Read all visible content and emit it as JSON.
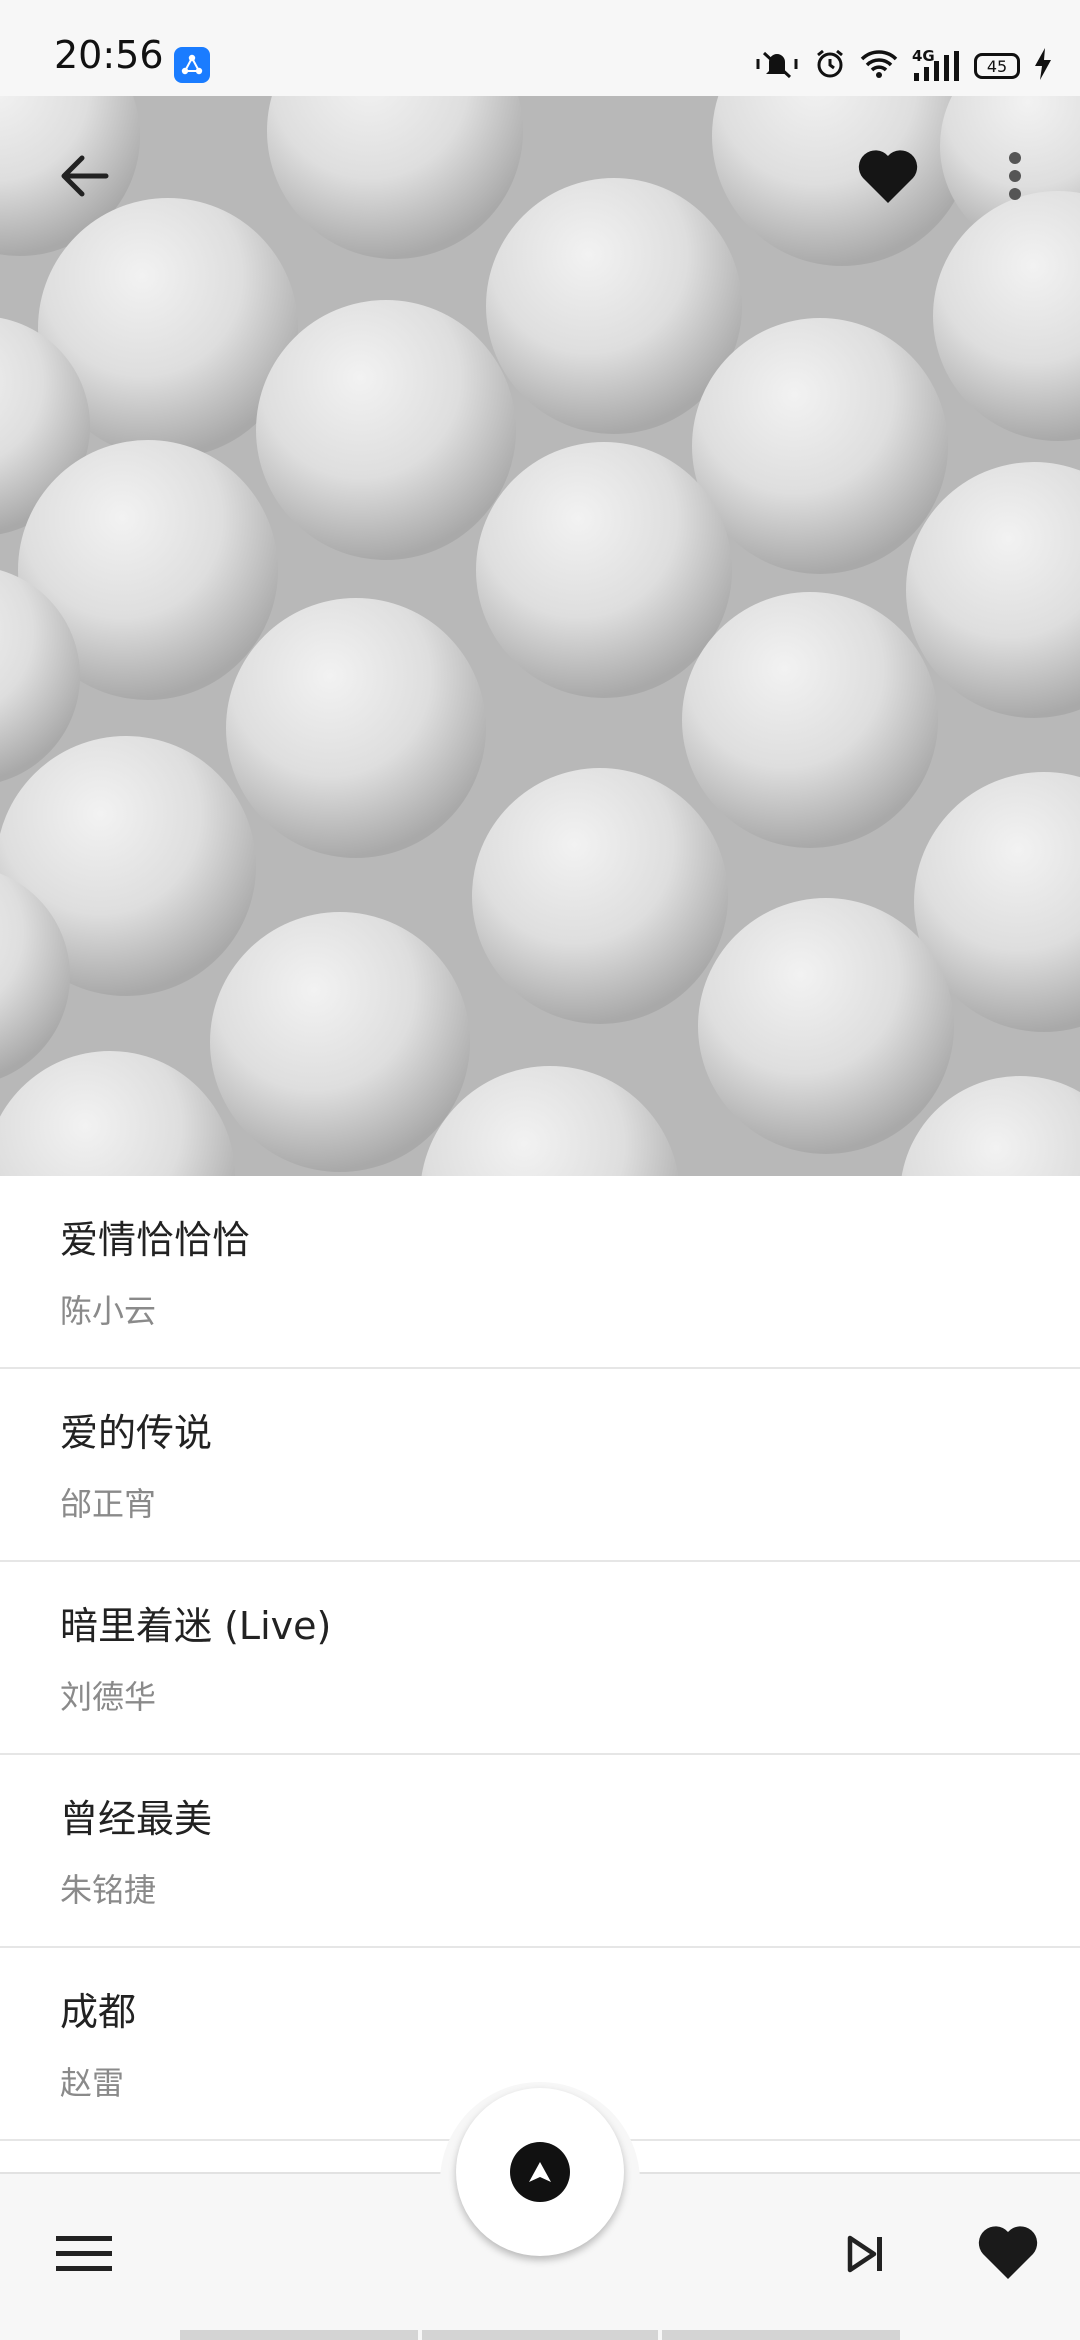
{
  "status_bar": {
    "time": "20:56",
    "app_icon": "app-share-icon",
    "icons": [
      "mute-vibrate-icon",
      "alarm-icon",
      "wifi-icon",
      "signal-4g-icon",
      "battery-icon",
      "charging-icon"
    ],
    "network": "4G",
    "battery_level": "45"
  },
  "header": {
    "back_icon": "arrow-left-icon",
    "favorite_icon": "heart-icon",
    "more_icon": "more-vertical-icon"
  },
  "songs": [
    {
      "title": "爱情恰恰恰",
      "artist": "陈小云"
    },
    {
      "title": "爱的传说",
      "artist": "邰正宵"
    },
    {
      "title": "暗里着迷 (Live)",
      "artist": "刘德华"
    },
    {
      "title": "曾经最美",
      "artist": "朱铭捷"
    },
    {
      "title": "成都",
      "artist": "赵雷"
    }
  ],
  "bottom_bar": {
    "menu_icon": "menu-icon",
    "play_icon": "play-icon",
    "next_icon": "skip-next-icon",
    "favorite_icon": "heart-icon"
  },
  "colors": {
    "accent": "#111111",
    "status_app_icon": "#1a7cff",
    "divider": "#e6e6e6",
    "artist_text": "#8a8a8a"
  }
}
